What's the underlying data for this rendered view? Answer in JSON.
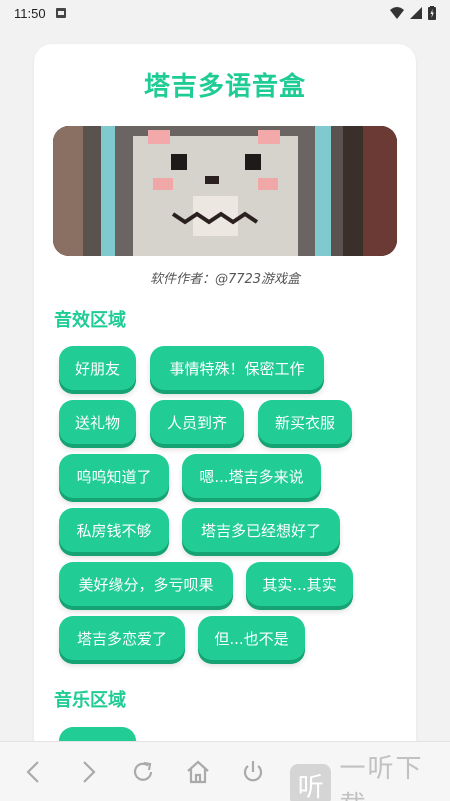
{
  "status_bar": {
    "time": "11:50"
  },
  "card": {
    "title": "塔吉多语音盒",
    "author": "软件作者：@7723游戏盒",
    "sfx_section_title": "音效区域",
    "music_section_title": "音乐区域"
  },
  "sound_buttons": [
    "好朋友",
    "事情特殊！保密工作",
    "送礼物",
    "人员到齐",
    "新买衣服",
    "呜呜知道了",
    "嗯...塔吉多来说",
    "私房钱不够",
    "塔吉多已经想好了",
    "美好缘分，多亏呗果",
    "其实...其实",
    "塔吉多恋爱了",
    "但...也不是"
  ],
  "watermark": {
    "icon_char": "听",
    "text": "一听下载"
  },
  "colors": {
    "accent": "#21cc95",
    "title": "#1fcc94",
    "background": "#f1f2f1"
  }
}
